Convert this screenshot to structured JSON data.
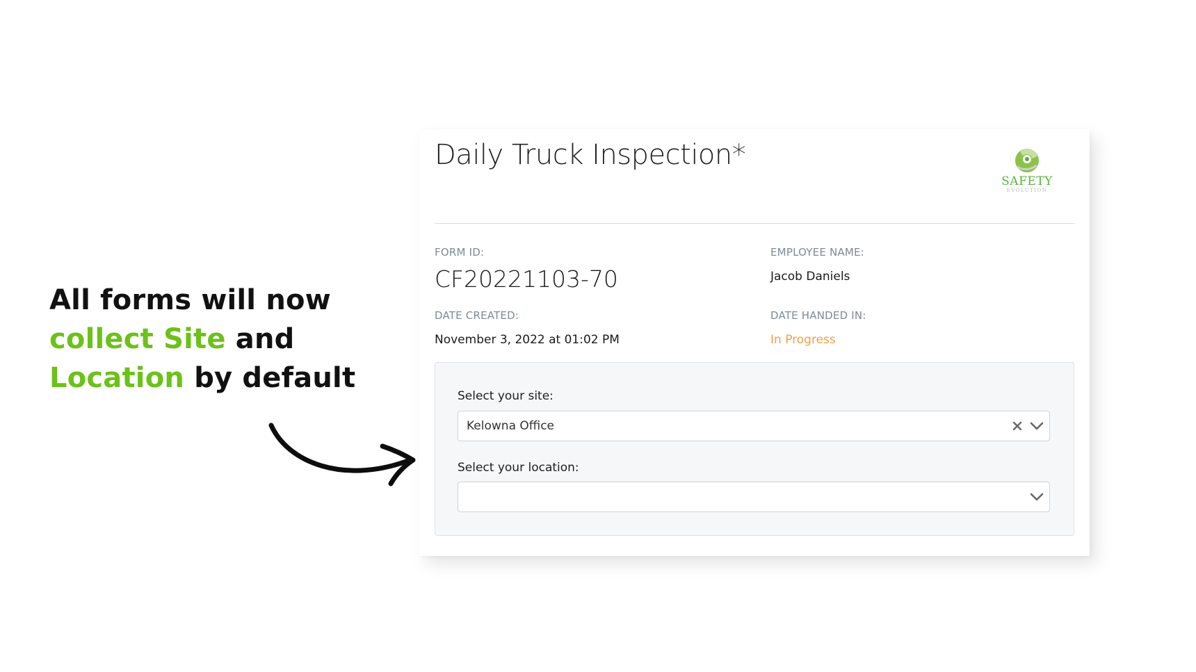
{
  "promo": {
    "line1": "All forms will now",
    "line2_accent": "collect Site",
    "line2_rest": " and",
    "line3_accent": "Location",
    "line3_rest": " by default",
    "text_color": "#111111",
    "accent_color": "#6cc11a"
  },
  "form": {
    "title": "Daily Truck Inspection*",
    "logo": {
      "word": "SAFETY",
      "sub": "EVOLUTION",
      "color": "#59b33a"
    },
    "form_id_label": "FORM ID:",
    "form_id": "CF20221103-70",
    "employee_name_label": "EMPLOYEE NAME:",
    "employee_name": "Jacob Daniels",
    "date_created_label": "DATE CREATED:",
    "date_created": "November 3, 2022 at 01:02 PM",
    "date_handed_in_label": "DATE HANDED IN:",
    "date_handed_in": "In Progress",
    "status_color": "#f0a046"
  },
  "site_field": {
    "label": "Select your site:",
    "value": "Kelowna Office"
  },
  "location_field": {
    "label": "Select your location:",
    "value": ""
  },
  "icons": {
    "clear": "clear-x-icon",
    "chevron": "chevron-down-icon",
    "arrow": "curved-arrow-icon",
    "logo": "safety-evolution-logo"
  }
}
